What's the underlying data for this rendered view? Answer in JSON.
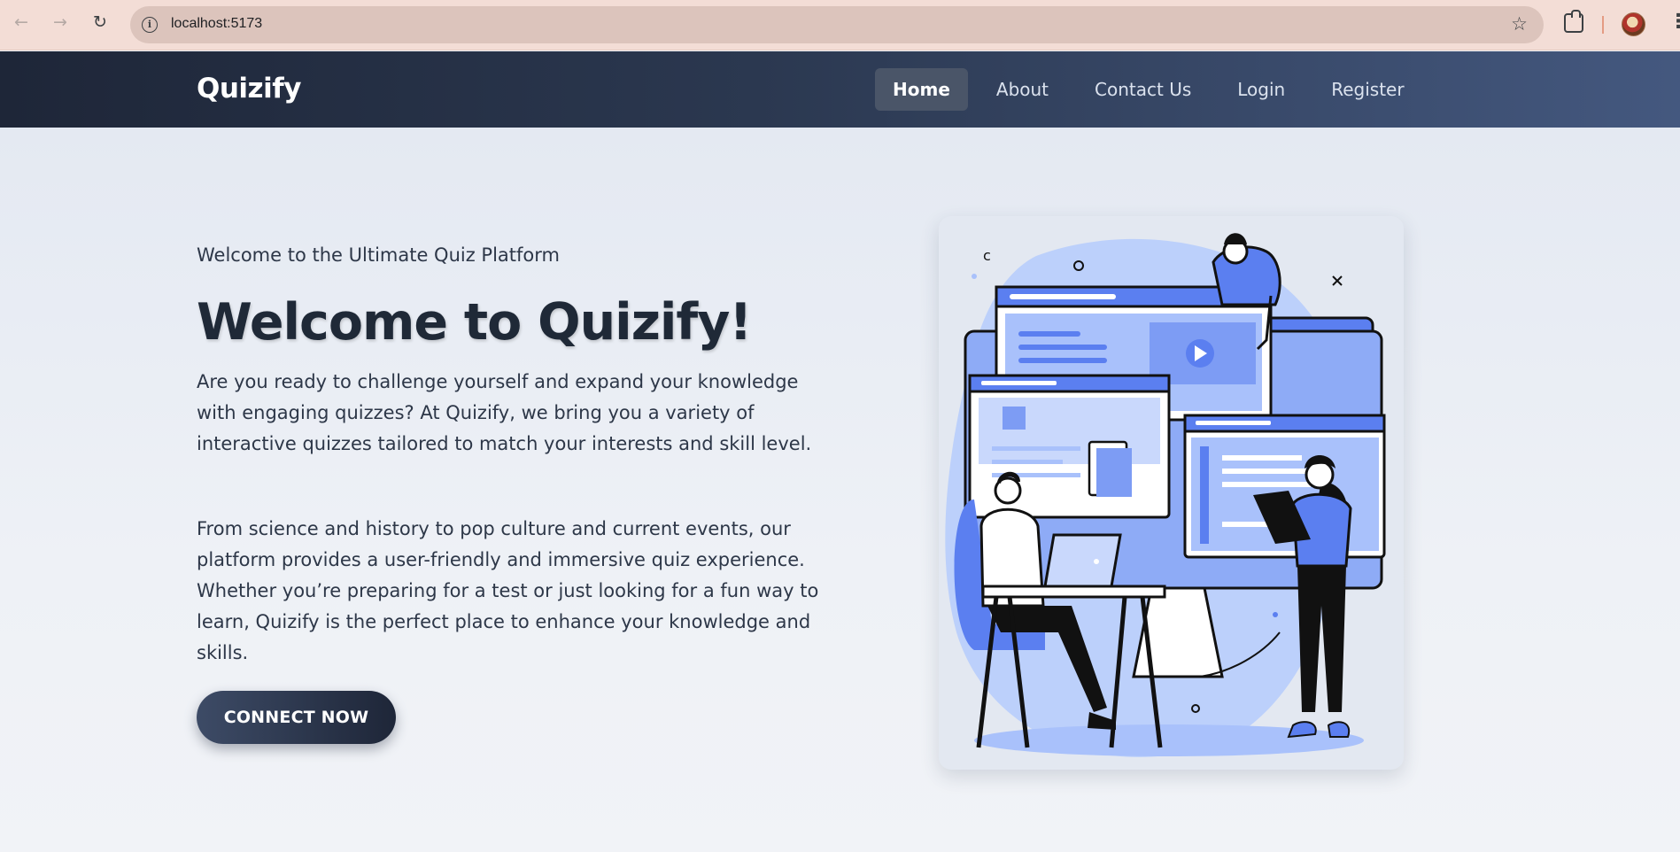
{
  "browser": {
    "url": "localhost:5173"
  },
  "header": {
    "brand": "Quizify",
    "nav": [
      {
        "label": "Home",
        "active": true
      },
      {
        "label": "About",
        "active": false
      },
      {
        "label": "Contact Us",
        "active": false
      },
      {
        "label": "Login",
        "active": false
      },
      {
        "label": "Register",
        "active": false
      }
    ]
  },
  "hero": {
    "tagline": "Welcome to the Ultimate Quiz Platform",
    "headline": "Welcome to Quizify!",
    "paragraph_1": "Are you ready to challenge yourself and expand your knowledge with engaging quizzes? At Quizify, we bring you a variety of interactive quizzes tailored to match your interests and skill level.",
    "paragraph_2": "From science and history to pop culture and current events, our platform provides a user-friendly and immersive quiz experience. Whether you’re preparing for a test or just looking for a fun way to learn, Quizify is the perfect place to enhance your knowledge and skills.",
    "cta_label": "CONNECT NOW"
  },
  "icons": {
    "back": "arrow-left-icon",
    "forward": "arrow-right-icon",
    "reload": "reload-icon",
    "site_info": "info-icon",
    "bookmark": "star-icon",
    "extensions": "puzzle-icon",
    "menu": "more-vert-icon"
  },
  "colors": {
    "header_start": "#1e2638",
    "header_end": "#44587f",
    "accent_blue": "#5b7ff0",
    "light_blue": "#a9c1fb",
    "text_dark": "#1f2937"
  }
}
